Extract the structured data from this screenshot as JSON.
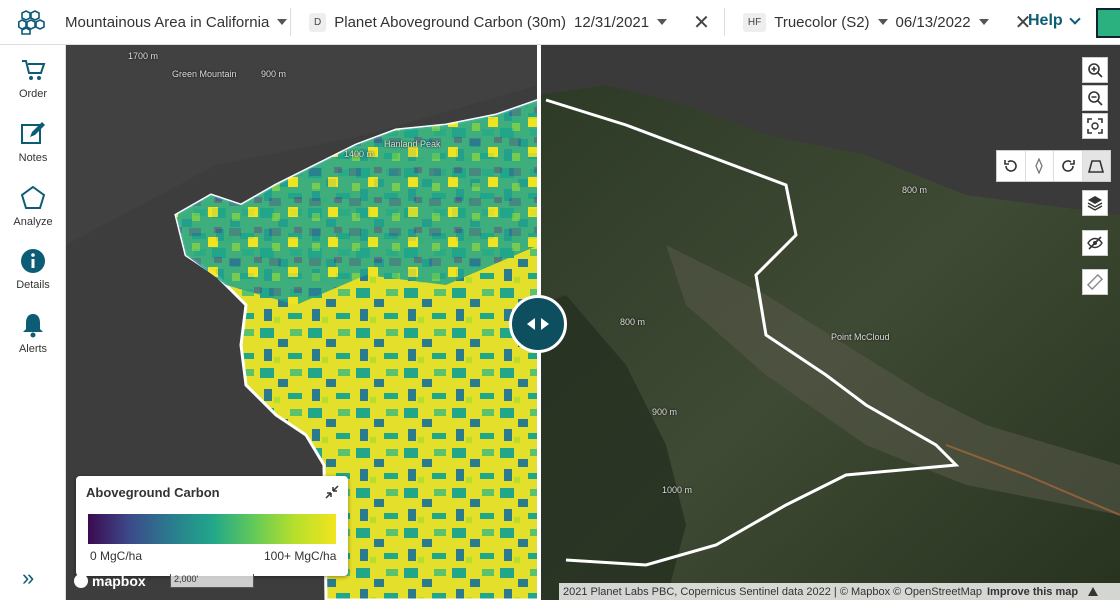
{
  "header": {
    "area_name": "Mountainous Area in California",
    "left_layer": {
      "badge": "D",
      "name": "Planet Aboveground Carbon (30m)",
      "date": "12/31/2021"
    },
    "right_layer": {
      "badge": "HF",
      "name": "Truecolor (S2)",
      "date": "06/13/2022"
    },
    "help_label": "Help"
  },
  "sidebar": {
    "items": [
      {
        "label": "Order",
        "icon": "cart-icon"
      },
      {
        "label": "Notes",
        "icon": "edit-icon"
      },
      {
        "label": "Analyze",
        "icon": "polygon-icon"
      },
      {
        "label": "Details",
        "icon": "info-icon"
      },
      {
        "label": "Alerts",
        "icon": "bell-icon"
      }
    ]
  },
  "map": {
    "labels": {
      "green_mountain": "Green Mountain",
      "hanland_peak": "Hanland Peak",
      "point_mccloud": "Point McCloud",
      "c1700": "1700 m",
      "c900": "900 m",
      "c1400": "1400 m",
      "c800a": "800 m",
      "c800b": "800 m",
      "c1000": "1000 m",
      "c900b": "900 m"
    }
  },
  "legend": {
    "title": "Aboveground Carbon",
    "min_label": "0 MgC/ha",
    "max_label": "100+ MgC/ha",
    "colors": [
      "#3b0a50",
      "#3c4a8a",
      "#2a7b8e",
      "#21a68a",
      "#62c95a",
      "#b6df2c",
      "#f2e51e"
    ]
  },
  "branding": {
    "mapbox": "mapbox",
    "scale": "2,000'"
  },
  "attribution": {
    "text": "2021 Planet Labs PBC, Copernicus Sentinel data 2022 | © Mapbox © OpenStreetMap",
    "improve": "Improve this map"
  },
  "colors": {
    "accent": "#0d5c75",
    "carbon_high": "#f2e51e",
    "carbon_mid": "#21a68a"
  }
}
